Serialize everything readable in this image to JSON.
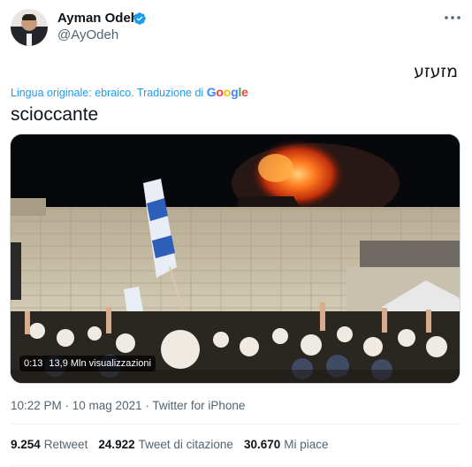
{
  "author": {
    "name": "Ayman Odeh",
    "handle": "@AyOdeh"
  },
  "tweet": {
    "original_text": "מזעזע",
    "translation_prefix": "Lingua originale: ebraico. Traduzione di ",
    "translation_provider": "Google",
    "translated_text": "scioccante"
  },
  "video": {
    "duration": "0:13",
    "views": "13,9 Mln visualizzazioni"
  },
  "meta": {
    "timestamp": "10:22 PM · 10 mag 2021 · Twitter for iPhone"
  },
  "stats": {
    "retweets": {
      "count": "9.254",
      "label": "Retweet"
    },
    "quote_tweets": {
      "count": "24.922",
      "label": "Tweet di citazione"
    },
    "likes": {
      "count": "30.670",
      "label": "Mi piace"
    }
  },
  "colors": {
    "accent": "#1d9bf0",
    "secondary_text": "#536471",
    "primary_text": "#0f1419",
    "divider": "#eff3f4"
  },
  "icons": [
    "verified-badge-icon",
    "more-options-icon"
  ]
}
